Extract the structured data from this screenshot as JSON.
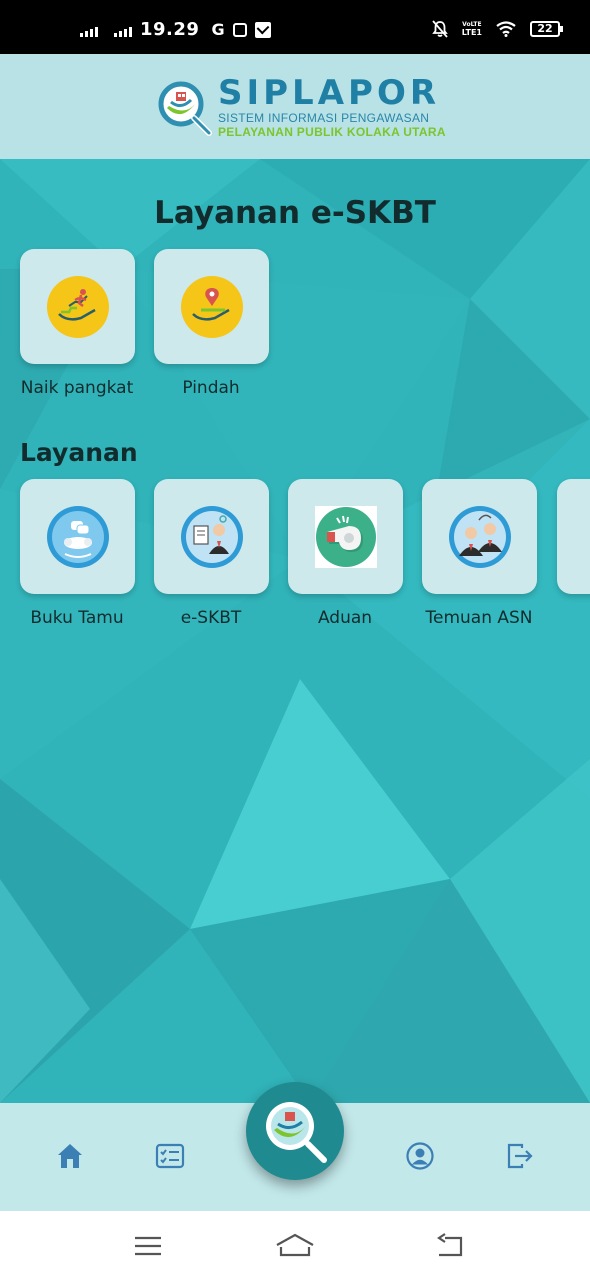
{
  "status_bar": {
    "time": "19.29",
    "g_icon": "G",
    "network_label_top": "VoLTE",
    "network_label_bottom": "LTE1",
    "battery": "22"
  },
  "header": {
    "app_name": "SIPLAPOR",
    "subtitle_line1": "SISTEM INFORMASI PENGAWASAN",
    "subtitle_line2": "PELAYANAN PUBLIK KOLAKA UTARA"
  },
  "eskbt_section": {
    "title": "Layanan e-SKBT",
    "items": [
      {
        "label": "Naik pangkat",
        "icon": "promotion-icon"
      },
      {
        "label": "Pindah",
        "icon": "relocation-icon"
      }
    ]
  },
  "layanan_section": {
    "title": "Layanan",
    "items": [
      {
        "label": "Buku Tamu",
        "icon": "guestbook-icon"
      },
      {
        "label": "e-SKBT",
        "icon": "eskbt-icon"
      },
      {
        "label": "Aduan",
        "icon": "whistle-icon"
      },
      {
        "label": "Temuan ASN",
        "icon": "asn-findings-icon"
      }
    ]
  },
  "bottom_nav": {
    "items": [
      "home-icon",
      "list-icon",
      "search-fab",
      "profile-icon",
      "logout-icon"
    ]
  },
  "colors": {
    "main_bg": "#30b3b9",
    "header_bg": "#b8e2e6",
    "tile_bg": "#cde9eb",
    "brand_blue": "#1f7fa5",
    "brand_green": "#7cc52c",
    "icon_yellow": "#f5c518",
    "nav_icon": "#3b7fb5"
  }
}
